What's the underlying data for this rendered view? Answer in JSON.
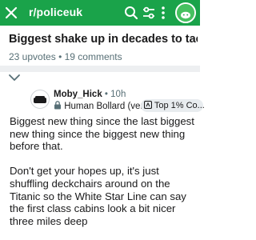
{
  "topbar": {
    "title": "r/policeuk",
    "icons": [
      "close-icon",
      "search-icon",
      "filter-icon",
      "more-icon",
      "avatar"
    ],
    "color": "#1aa34a"
  },
  "post": {
    "title": "Biggest shake up in decades to tackle loca...",
    "upvotes": "23 upvotes",
    "comments": "19 comments"
  },
  "comment": {
    "username": "Moby_Hick",
    "age": "10h",
    "flair": "Human Bollard (verified)",
    "badge": "Top 1% Co...",
    "paragraph1": "Biggest new thing since the last biggest new thing since the biggest new thing before that.",
    "paragraph2": "Don't get your hopes up, it's just shuffling deckchairs around on the Titanic so the White Star Line can say the first class cabins look a bit nicer three miles deep"
  }
}
